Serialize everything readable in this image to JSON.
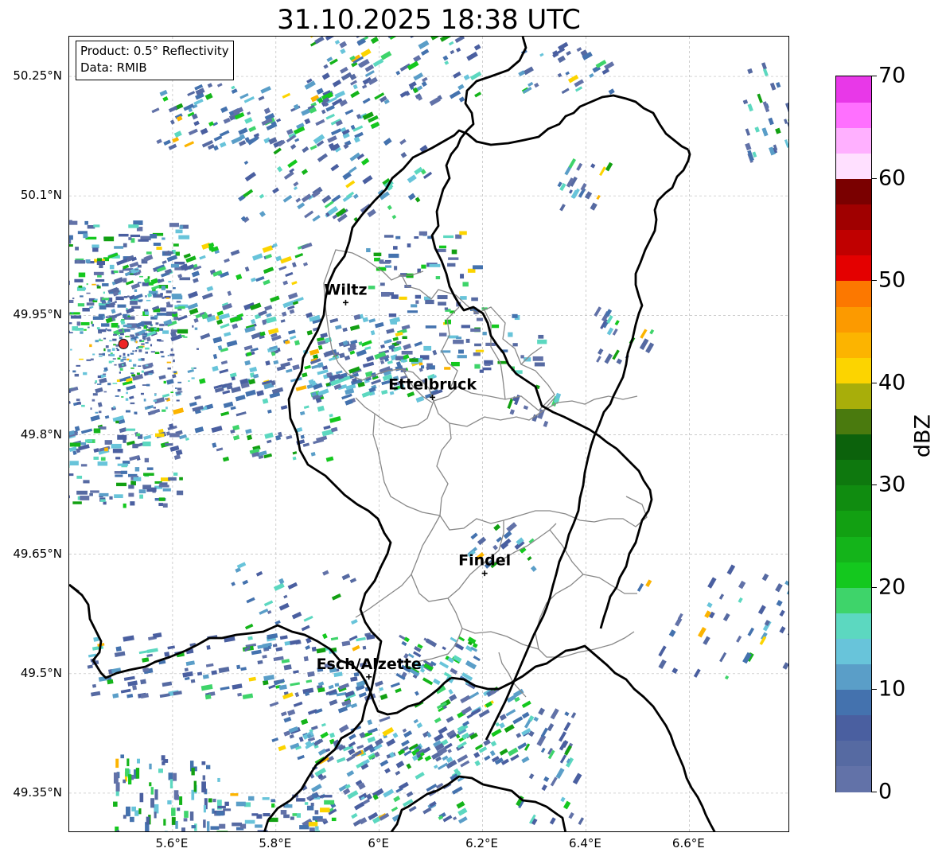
{
  "title": "31.10.2025 18:38 UTC",
  "info_box": {
    "product": "Product: 0.5° Reflectivity",
    "data_source": "Data: RMIB"
  },
  "lat_labels": [
    "50.25°N",
    "50.1°N",
    "49.95°N",
    "49.8°N",
    "49.65°N",
    "49.5°N",
    "49.35°N"
  ],
  "lon_labels": [
    "5.6°E",
    "5.8°E",
    "6°E",
    "6.2°E",
    "6.4°E",
    "6.6°E"
  ],
  "cities": [
    {
      "name": "Wiltz",
      "lon": 5.935,
      "lat": 49.966
    },
    {
      "name": "Ettelbruck",
      "lon": 6.103,
      "lat": 49.847
    },
    {
      "name": "Findel",
      "lon": 6.204,
      "lat": 49.626
    },
    {
      "name": "Esch/Alzette",
      "lon": 5.98,
      "lat": 49.496
    }
  ],
  "radar_site": {
    "lon": 5.505,
    "lat": 49.914,
    "color": "#ee2222"
  },
  "colorbar": {
    "label": "dBZ",
    "ticks": [
      "0",
      "10",
      "20",
      "30",
      "40",
      "50",
      "60",
      "70"
    ],
    "min": 0,
    "max": 70,
    "step": 2.5,
    "colors": [
      "#6272a8",
      "#566aa2",
      "#4a5fa0",
      "#4472ae",
      "#5a9ec8",
      "#68c4da",
      "#5cd8c0",
      "#3ed46a",
      "#14c81e",
      "#14b41a",
      "#12a012",
      "#108c10",
      "#0e780e",
      "#0c620c",
      "#4a7a0e",
      "#a8ae0a",
      "#fcd400",
      "#fcb400",
      "#fc9a00",
      "#fc7800",
      "#e40000",
      "#c00000",
      "#a00000",
      "#7a0000",
      "#ffe0ff",
      "#ffb0ff",
      "#ff70ff",
      "#e838e8"
    ]
  }
}
